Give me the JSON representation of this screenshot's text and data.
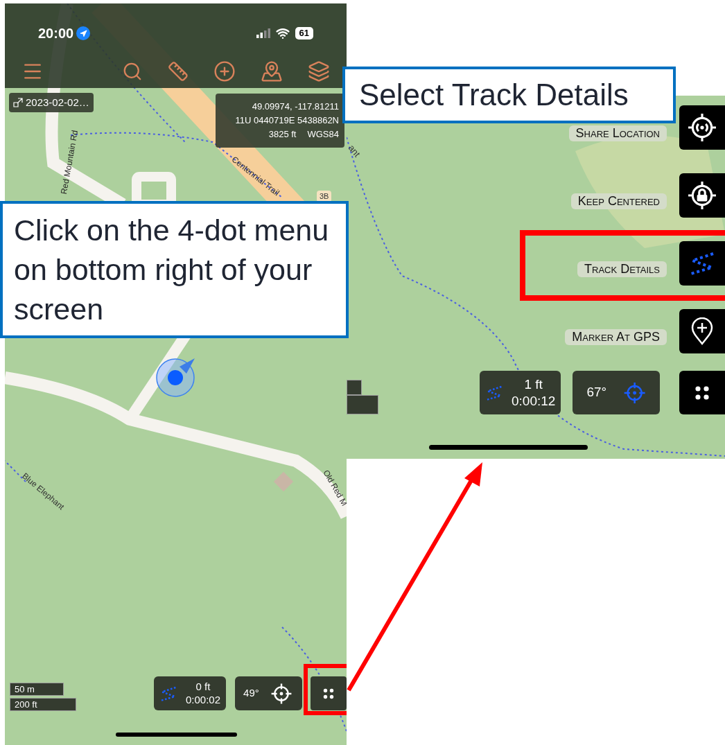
{
  "left_screen": {
    "status_bar": {
      "time": "20:00",
      "battery": "61"
    },
    "track_label": "2023-02-02…",
    "coordinates": [
      "49.09974, -117.81211",
      "11U 0440719E 5438862N"
    ],
    "elevation": "3825 ft",
    "datum": "WGS84",
    "map_labels": [
      "Red Mountain Rd",
      "Centennial Trail",
      "3B",
      "Blue Elephant",
      "Old Red M"
    ],
    "scale": [
      "50 m",
      "200 ft"
    ],
    "track_stats": {
      "distance": "0 ft",
      "time": "0:00:02"
    },
    "heading": "49°",
    "menu_button": {
      "highlighted": true
    }
  },
  "right_screen": {
    "map_labels": [
      "ant"
    ],
    "menu": [
      {
        "label": "Share Location",
        "kind": "share",
        "highlighted": false
      },
      {
        "label": "Keep Centered",
        "kind": "center",
        "highlighted": false
      },
      {
        "label": "Track Details",
        "kind": "track",
        "highlighted": true
      },
      {
        "label": "Marker At GPS",
        "kind": "marker",
        "highlighted": false
      }
    ],
    "track_stats": {
      "distance": "1 ft",
      "time": "0:00:12"
    },
    "heading": "67°"
  },
  "callouts": [
    {
      "text": "Select Track Details"
    },
    {
      "text": "Click on the 4-dot menu on bottom right of your screen"
    }
  ]
}
